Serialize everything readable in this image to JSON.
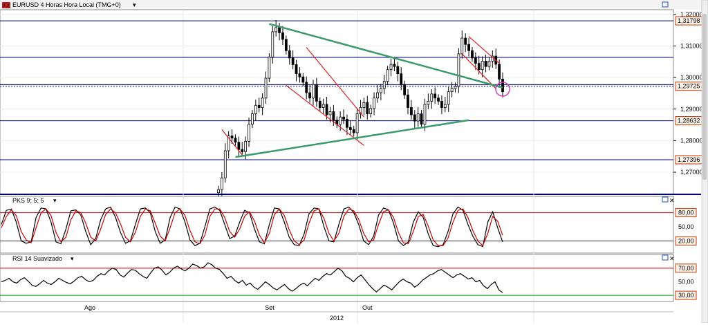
{
  "window": {
    "title": "EURUSD 4 Horas Hora Local (TMG+0)",
    "icon": "fx-icon"
  },
  "colors": {
    "hline": "#000080",
    "trend_green": "#3a9a6a",
    "channel_red": "#e02020",
    "candle": "#000000",
    "stoch_k": "#000000",
    "stoch_d": "#cc0000",
    "rsi": "#000000",
    "circle": "#d040c0",
    "price_tag_border": "#cc3300",
    "price_tag_bg": "#fff4ea",
    "level_70": "#cc0000",
    "level_30": "#009900"
  },
  "chart_data": [
    {
      "type": "candlestick",
      "panel": "price",
      "title": "EURUSD 4 Horas Hora Local (TMG+0)",
      "ylim": [
        1.263,
        1.3215
      ],
      "y_ticks": [
        "1,32000",
        "1,31000",
        "1,30000",
        "1,29000",
        "1,28000",
        "1,27000"
      ],
      "y_tick_values": [
        1.32,
        1.31,
        1.3,
        1.29,
        1.28,
        1.27
      ],
      "horizontal_levels": [
        {
          "value": 1.31798,
          "label": "1,31798"
        },
        {
          "value": 1.30637,
          "label": ""
        },
        {
          "value": 1.29725,
          "label": "1,29725",
          "style": "dotted"
        },
        {
          "value": 1.29775,
          "label": ""
        },
        {
          "value": 1.28632,
          "label": "1,28632"
        },
        {
          "value": 1.27396,
          "label": "1,27396"
        }
      ],
      "close_series": [
        1.2645,
        1.2682,
        1.2768,
        1.2815,
        1.2808,
        1.2795,
        1.2772,
        1.2765,
        1.2798,
        1.2852,
        1.2885,
        1.2912,
        1.2905,
        1.2935,
        1.2998,
        1.3065,
        1.3145,
        1.3158,
        1.3142,
        1.3121,
        1.3085,
        1.3062,
        1.3041,
        1.3012,
        1.3002,
        1.2985,
        1.2952,
        1.2935,
        1.2978,
        1.2925,
        1.2905,
        1.2915,
        1.2882,
        1.2892,
        1.2865,
        1.2852,
        1.2875,
        1.2868,
        1.2842,
        1.2835,
        1.2825,
        1.2885,
        1.2905,
        1.2921,
        1.2885,
        1.2902,
        1.2935,
        1.2952,
        1.2965,
        1.2988,
        1.3025,
        1.3042,
        1.3035,
        1.3012,
        1.2978,
        1.2945,
        1.2905,
        1.2882,
        1.2862,
        1.2885,
        1.2852,
        1.2915,
        1.2925,
        1.2948,
        1.2935,
        1.2925,
        1.2905,
        1.2915,
        1.2955,
        1.2965,
        1.2972,
        1.3075,
        1.3125,
        1.3105,
        1.3085,
        1.3062,
        1.3045,
        1.3025,
        1.3052,
        1.3035,
        1.3052,
        1.3068,
        1.3042,
        1.2995,
        1.2955
      ],
      "channels": [
        {
          "name": "",
          "color": "red",
          "points": [
            [
              1,
              1.2835
            ],
            [
              7,
              1.2755
            ]
          ]
        },
        {
          "name": "",
          "color": "red",
          "points": [
            [
              26,
              1.3095
            ],
            [
              43,
              1.2875
            ]
          ]
        },
        {
          "name": "",
          "color": "red",
          "points": [
            [
              20,
              1.2975
            ],
            [
              43,
              1.2785
            ]
          ]
        },
        {
          "name": "",
          "color": "red",
          "points": [
            [
              74,
              1.313
            ],
            [
              83,
              1.3045
            ]
          ]
        },
        {
          "name": "",
          "color": "red",
          "points": [
            [
              72,
              1.3075
            ],
            [
              82,
              1.2965
            ]
          ]
        }
      ],
      "trendlines": [
        {
          "color": "green",
          "points": [
            [
              15,
              1.317
            ],
            [
              84,
              1.2968
            ]
          ]
        },
        {
          "color": "green",
          "points": [
            [
              5,
              1.2748
            ],
            [
              74,
              1.2865
            ]
          ]
        }
      ],
      "annotations": [
        {
          "type": "circle",
          "x": 84,
          "y": 1.2963
        }
      ],
      "x_period_labels": [
        "Ago",
        "Set",
        "Out"
      ],
      "year_label": "2012"
    },
    {
      "type": "line",
      "panel": "stochastic",
      "title": "PKS 9; 5; 5",
      "ylim": [
        0,
        100
      ],
      "y_ticks": [
        "80,00",
        "50,00",
        "20,00"
      ],
      "levels": [
        80,
        20
      ],
      "series": [
        {
          "name": "",
          "color": "black",
          "values": [
            55,
            85,
            88,
            60,
            20,
            15,
            18,
            70,
            90,
            88,
            60,
            18,
            14,
            45,
            84,
            86,
            75,
            40,
            12,
            25,
            65,
            88,
            92,
            70,
            38,
            15,
            20,
            55,
            88,
            90,
            80,
            40,
            15,
            22,
            70,
            92,
            88,
            60,
            22,
            10,
            15,
            50,
            88,
            92,
            85,
            55,
            25,
            30,
            60,
            85,
            80,
            45,
            18,
            14,
            55,
            90,
            88,
            60,
            28,
            12,
            10,
            35,
            78,
            90,
            88,
            50,
            20,
            18,
            55,
            88,
            92,
            80,
            55,
            20,
            12,
            30,
            75,
            90,
            86,
            58,
            20,
            10,
            18,
            60,
            82,
            70,
            35,
            10,
            8,
            12,
            40,
            78,
            92,
            85,
            55,
            30,
            12,
            8,
            60,
            82,
            48,
            18
          ]
        },
        {
          "name": "",
          "color": "red",
          "values": [
            48,
            72,
            86,
            74,
            40,
            22,
            16,
            48,
            80,
            88,
            74,
            38,
            18,
            28,
            65,
            84,
            80,
            58,
            28,
            20,
            45,
            76,
            88,
            80,
            56,
            28,
            18,
            38,
            72,
            88,
            84,
            58,
            30,
            20,
            48,
            80,
            88,
            74,
            42,
            18,
            14,
            32,
            72,
            88,
            88,
            70,
            40,
            28,
            45,
            72,
            82,
            62,
            32,
            16,
            36,
            76,
            88,
            74,
            44,
            20,
            12,
            22,
            58,
            84,
            88,
            68,
            36,
            20,
            36,
            72,
            88,
            84,
            66,
            36,
            18,
            22,
            55,
            82,
            86,
            70,
            38,
            16,
            14,
            40,
            72,
            76,
            52,
            22,
            10,
            10,
            26,
            60,
            85,
            88,
            70,
            42,
            20,
            10,
            36,
            72,
            62,
            32
          ]
        }
      ]
    },
    {
      "type": "line",
      "panel": "rsi",
      "title": "RSI 14 Suavizado",
      "ylim": [
        25,
        80
      ],
      "y_ticks": [
        "70,00",
        "50,00",
        "30,00"
      ],
      "levels": [
        70,
        30
      ],
      "series": [
        {
          "name": "",
          "color": "black",
          "values": [
            50,
            52,
            55,
            50,
            48,
            53,
            56,
            51,
            45,
            43,
            47,
            52,
            48,
            46,
            50,
            55,
            52,
            49,
            47,
            51,
            56,
            58,
            53,
            50,
            52,
            58,
            62,
            60,
            66,
            70,
            68,
            60,
            57,
            63,
            68,
            67,
            62,
            58,
            55,
            63,
            70,
            72,
            67,
            60,
            64,
            70,
            73,
            69,
            66,
            70,
            76,
            74,
            70,
            72,
            78,
            75,
            70,
            68,
            62,
            55,
            58,
            52,
            48,
            52,
            45,
            48,
            42,
            39,
            44,
            50,
            46,
            41,
            38,
            42,
            46,
            40,
            36,
            40,
            45,
            48,
            44,
            50,
            55,
            52,
            58,
            62,
            60,
            65,
            70,
            66,
            58,
            55,
            50,
            56,
            60,
            53,
            46,
            40,
            35,
            40,
            45,
            42,
            38,
            44,
            50,
            54,
            50,
            48,
            42,
            46,
            52,
            56,
            60,
            62,
            66,
            68,
            64,
            60,
            56,
            60,
            62,
            58,
            54,
            56,
            50,
            52,
            44,
            40,
            46,
            50,
            38,
            34
          ]
        }
      ]
    }
  ]
}
